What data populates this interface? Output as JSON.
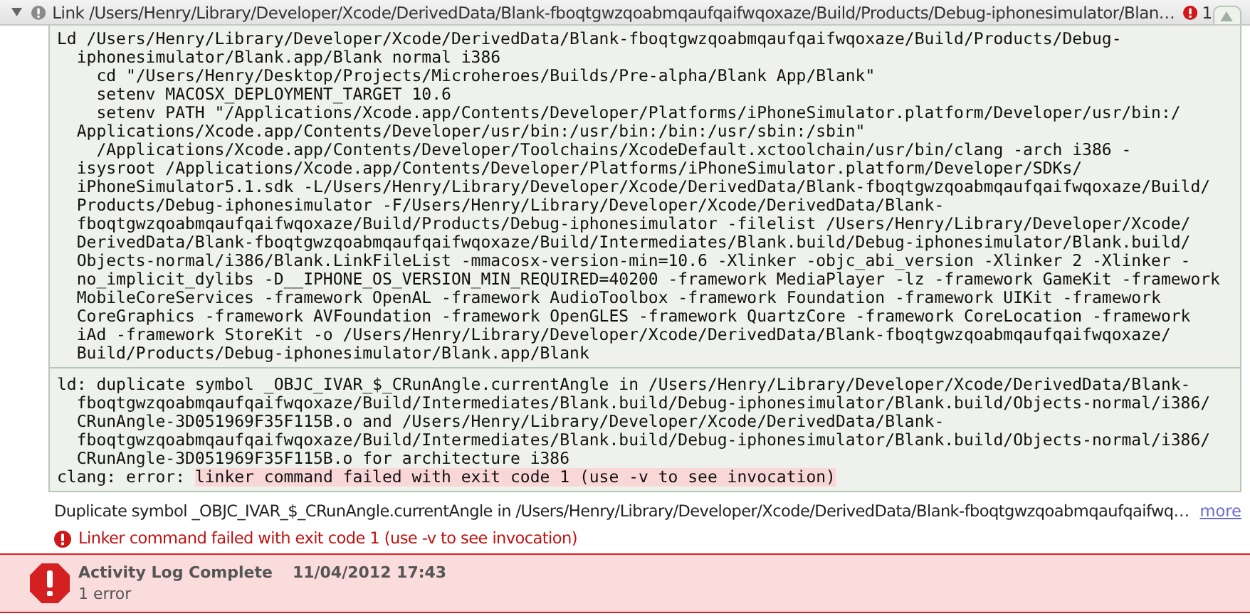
{
  "header": {
    "expanded": true,
    "title": "Link /Users/Henry/Library/Developer/Xcode/DerivedData/Blank-fboqtgwzqoabmqaufqaifwqoxaze/Build/Products/Debug-iphonesimulator/Blan…",
    "error_count": "1"
  },
  "transcript": [
    {
      "lines": [
        {
          "text": "Ld /Users/Henry/Library/Developer/Xcode/DerivedData/Blank-fboqtgwzqoabmqaufqaifwqoxaze/Build/Products/Debug-"
        },
        {
          "text": "  iphonesimulator/Blank.app/Blank normal i386"
        },
        {
          "text": "    cd \"/Users/Henry/Desktop/Projects/Microheroes/Builds/Pre-alpha/Blank App/Blank\""
        },
        {
          "text": "    setenv MACOSX_DEPLOYMENT_TARGET 10.6"
        },
        {
          "text": "    setenv PATH \"/Applications/Xcode.app/Contents/Developer/Platforms/iPhoneSimulator.platform/Developer/usr/bin:/"
        },
        {
          "text": "  Applications/Xcode.app/Contents/Developer/usr/bin:/usr/bin:/bin:/usr/sbin:/sbin\""
        },
        {
          "text": "    /Applications/Xcode.app/Contents/Developer/Toolchains/XcodeDefault.xctoolchain/usr/bin/clang -arch i386 -"
        },
        {
          "text": "  isysroot /Applications/Xcode.app/Contents/Developer/Platforms/iPhoneSimulator.platform/Developer/SDKs/"
        },
        {
          "text": "  iPhoneSimulator5.1.sdk -L/Users/Henry/Library/Developer/Xcode/DerivedData/Blank-fboqtgwzqoabmqaufqaifwqoxaze/Build/"
        },
        {
          "text": "  Products/Debug-iphonesimulator -F/Users/Henry/Library/Developer/Xcode/DerivedData/Blank-"
        },
        {
          "text": "  fboqtgwzqoabmqaufqaifwqoxaze/Build/Products/Debug-iphonesimulator -filelist /Users/Henry/Library/Developer/Xcode/"
        },
        {
          "text": "  DerivedData/Blank-fboqtgwzqoabmqaufqaifwqoxaze/Build/Intermediates/Blank.build/Debug-iphonesimulator/Blank.build/"
        },
        {
          "text": "  Objects-normal/i386/Blank.LinkFileList -mmacosx-version-min=10.6 -Xlinker -objc_abi_version -Xlinker 2 -Xlinker -"
        },
        {
          "text": "  no_implicit_dylibs -D__IPHONE_OS_VERSION_MIN_REQUIRED=40200 -framework MediaPlayer -lz -framework GameKit -framework"
        },
        {
          "text": "  MobileCoreServices -framework OpenAL -framework AudioToolbox -framework Foundation -framework UIKit -framework"
        },
        {
          "text": "  CoreGraphics -framework AVFoundation -framework OpenGLES -framework QuartzCore -framework CoreLocation -framework"
        },
        {
          "text": "  iAd -framework StoreKit -o /Users/Henry/Library/Developer/Xcode/DerivedData/Blank-fboqtgwzqoabmqaufqaifwqoxaze/"
        },
        {
          "text": "  Build/Products/Debug-iphonesimulator/Blank.app/Blank"
        }
      ]
    },
    {
      "lines": [
        {
          "text": "ld: duplicate symbol _OBJC_IVAR_$_CRunAngle.currentAngle in /Users/Henry/Library/Developer/Xcode/DerivedData/Blank-"
        },
        {
          "text": "  fboqtgwzqoabmqaufqaifwqoxaze/Build/Intermediates/Blank.build/Debug-iphonesimulator/Blank.build/Objects-normal/i386/"
        },
        {
          "text": "  CRunAngle-3D051969F35F115B.o and /Users/Henry/Library/Developer/Xcode/DerivedData/Blank-"
        },
        {
          "text": "  fboqtgwzqoabmqaufqaifwqoxaze/Build/Intermediates/Blank.build/Debug-iphonesimulator/Blank.build/Objects-normal/i386/"
        },
        {
          "text": "  CRunAngle-3D051969F35F115B.o for architecture i386"
        },
        {
          "text": "clang: error: ",
          "highlight": "linker command failed with exit code 1 (use -v to see invocation)"
        }
      ]
    }
  ],
  "messages": [
    {
      "kind": "note",
      "text": "Duplicate symbol _OBJC_IVAR_$_CRunAngle.currentAngle in /Users/Henry/Library/Developer/Xcode/DerivedData/Blank-fboqtgwzqoabmqaufqaifwq…",
      "link": "more"
    },
    {
      "kind": "error",
      "text": "Linker command failed with exit code 1 (use -v to see invocation)"
    }
  ],
  "summary": {
    "title": "Activity Log Complete",
    "date": "11/04/2012 17:43",
    "detail": "1 error"
  }
}
